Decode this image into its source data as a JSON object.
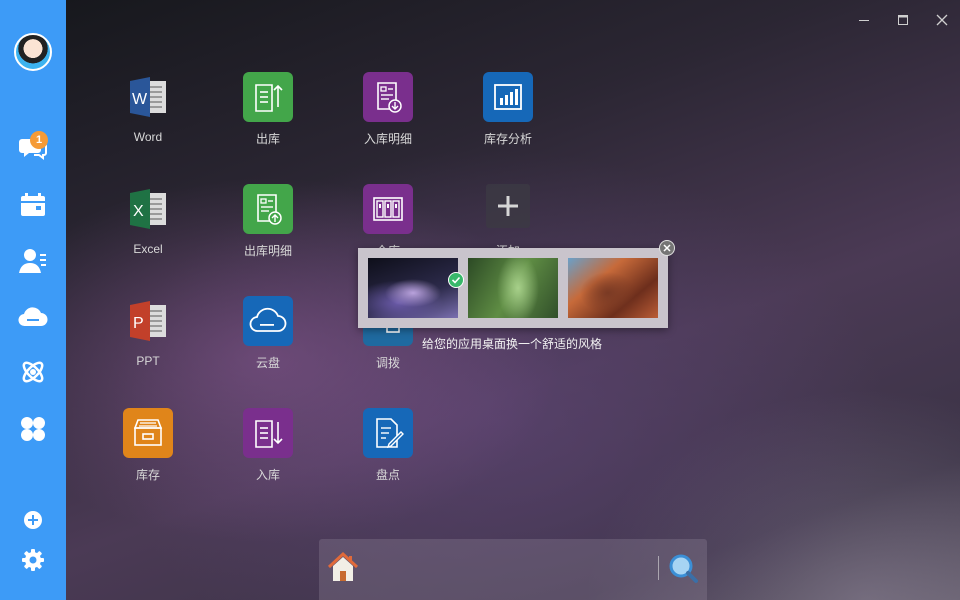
{
  "sidebar": {
    "notification_count": "1"
  },
  "apps": [
    {
      "label": "Word"
    },
    {
      "label": "出库"
    },
    {
      "label": "入库明细"
    },
    {
      "label": "库存分析"
    },
    {
      "label": "Excel"
    },
    {
      "label": "出库明细"
    },
    {
      "label": "仓库"
    },
    {
      "label": "添加"
    },
    {
      "label": "PPT"
    },
    {
      "label": "云盘"
    },
    {
      "label": "调拨"
    },
    {
      "label": "库存"
    },
    {
      "label": "入库"
    },
    {
      "label": "盘点"
    }
  ],
  "theme_picker": {
    "tip": "给您的应用桌面换一个舒适的风格",
    "selected_index": 0
  },
  "colors": {
    "sidebar": "#3d9bf7",
    "green_tile": "#43a64a",
    "purple_tile": "#7a2f8d",
    "blue_tile": "#1668b8",
    "badge": "#f59b37"
  }
}
